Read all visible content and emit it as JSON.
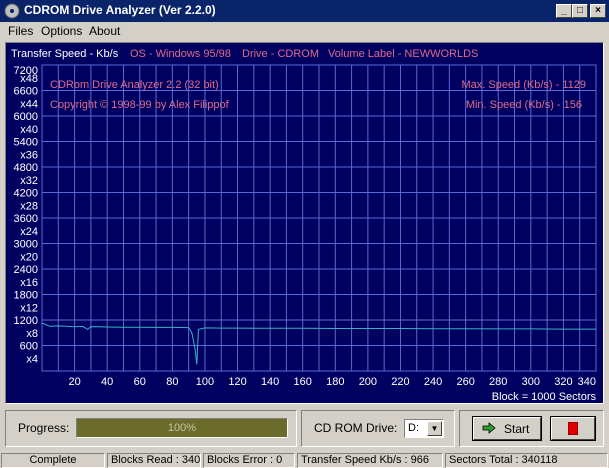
{
  "window": {
    "title": "CDROM Drive Analyzer (Ver 2.2.0)"
  },
  "menu": {
    "files": "Files",
    "options": "Options",
    "about": "About"
  },
  "header": {
    "transfer_speed": "Transfer Speed - Kb/s",
    "os": "OS - Windows 95/98",
    "drive": "Drive - CDROM",
    "volume": "Volume Label - NEWWORLDS"
  },
  "info": {
    "product": "CDRom Drive Analyzer 2.2 (32 bit)",
    "copyright": "Copyright © 1998-99 by Alex Filippof",
    "max_speed": "Max. Speed (Kb/s) - 1129",
    "min_speed": "Min.  Speed (Kb/s) - 156"
  },
  "chart_data": {
    "type": "line",
    "title": "Transfer Speed - Kb/s",
    "xlabel": "Block = 1000 Sectors",
    "xlim": [
      0,
      340
    ],
    "ylim": [
      0,
      7200
    ],
    "x_ticks": [
      "20",
      "40",
      "60",
      "80",
      "100",
      "120",
      "140",
      "160",
      "180",
      "200",
      "220",
      "240",
      "260",
      "280",
      "300",
      "320",
      "340"
    ],
    "y_tick_values": [
      7200,
      6600,
      6000,
      5400,
      4800,
      4200,
      3600,
      3000,
      2400,
      1800,
      1200,
      600
    ],
    "y_ticks": [
      "7200",
      "6600",
      "6000",
      "5400",
      "4800",
      "4200",
      "3600",
      "3000",
      "2400",
      "1800",
      "1200",
      "600"
    ],
    "y_multiplier_values": [
      6900,
      6300,
      5700,
      5100,
      4500,
      3900,
      3300,
      2700,
      2100,
      1500,
      900,
      300
    ],
    "y_multipliers": [
      "x48",
      "x44",
      "x40",
      "x36",
      "x32",
      "x28",
      "x24",
      "x20",
      "x16",
      "x12",
      "x8",
      "x4"
    ],
    "grid": true,
    "colors": {
      "background": "#000060",
      "grid": "#5a6ad6",
      "line": "#3ab0c8",
      "label": "#ffffff",
      "header": "#e06a8a"
    },
    "x": [
      0,
      5,
      10,
      15,
      20,
      25,
      28,
      30,
      35,
      40,
      50,
      60,
      70,
      80,
      90,
      92,
      94,
      95,
      96,
      100,
      110,
      120,
      140,
      160,
      180,
      200,
      220,
      240,
      260,
      280,
      300,
      320,
      340
    ],
    "values": [
      1129,
      1050,
      1060,
      1055,
      1040,
      1050,
      980,
      1045,
      1040,
      1035,
      1030,
      1030,
      1025,
      1025,
      1020,
      900,
      500,
      156,
      980,
      1015,
      1010,
      1010,
      1005,
      1005,
      1000,
      1000,
      1000,
      995,
      995,
      990,
      990,
      985,
      985
    ]
  },
  "controls": {
    "progress_label": "Progress:",
    "progress_text": "100%",
    "progress_value": 1.0,
    "drive_label": "CD ROM Drive:",
    "drive_value": "D:",
    "start_label": "Start"
  },
  "status": {
    "state": "Complete",
    "blocks_read": "Blocks Read : 340",
    "blocks_error": "Blocks Error : 0",
    "transfer_speed": "Transfer Speed Kb/s : 966",
    "sectors_total": "Sectors Total : 340118"
  }
}
